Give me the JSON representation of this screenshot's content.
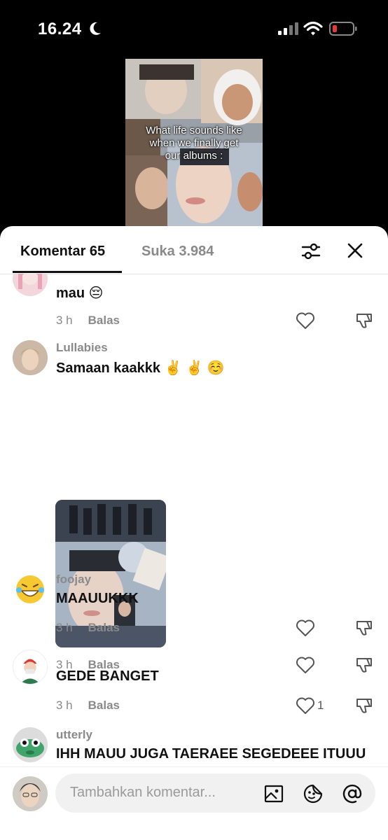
{
  "status_bar": {
    "time": "16.24"
  },
  "video": {
    "caption_lines": [
      "What life sounds like",
      "when we finally get",
      "our albums :"
    ]
  },
  "tabs": {
    "comments_label": "Komentar 65",
    "likes_label": "Suka 3.984"
  },
  "comments": [
    {
      "username": "",
      "text": "mau 😔",
      "time": "3 h",
      "reply_label": "Balas",
      "likes": ""
    },
    {
      "username": "Lullabies",
      "text": "Samaan kaakkk ✌️ ✌️ ☺️",
      "time": "3 h",
      "reply_label": "Balas",
      "likes": ""
    },
    {
      "username": "foojay",
      "text": "MAAUUKKK",
      "time": "3 h",
      "reply_label": "Balas",
      "likes": ""
    },
    {
      "username": "",
      "text": "GEDE BANGET",
      "time": "3 h",
      "reply_label": "Balas",
      "likes": "1"
    },
    {
      "username": "utterly",
      "text": "IHH MAUU JUGA TAERAEE SEGEDEEE ITUUU",
      "time": "",
      "reply_label": "",
      "likes": ""
    }
  ],
  "composer": {
    "placeholder": "Tambahkan komentar..."
  },
  "icons": [
    "moon-icon",
    "signal-icon",
    "wifi-icon",
    "battery-icon",
    "filter-icon",
    "close-icon",
    "heart-icon",
    "dislike-icon",
    "image-icon",
    "sticker-icon",
    "mention-icon"
  ],
  "colors": {
    "battery_low": "#e5383b",
    "text_muted": "#8a8a8a"
  }
}
